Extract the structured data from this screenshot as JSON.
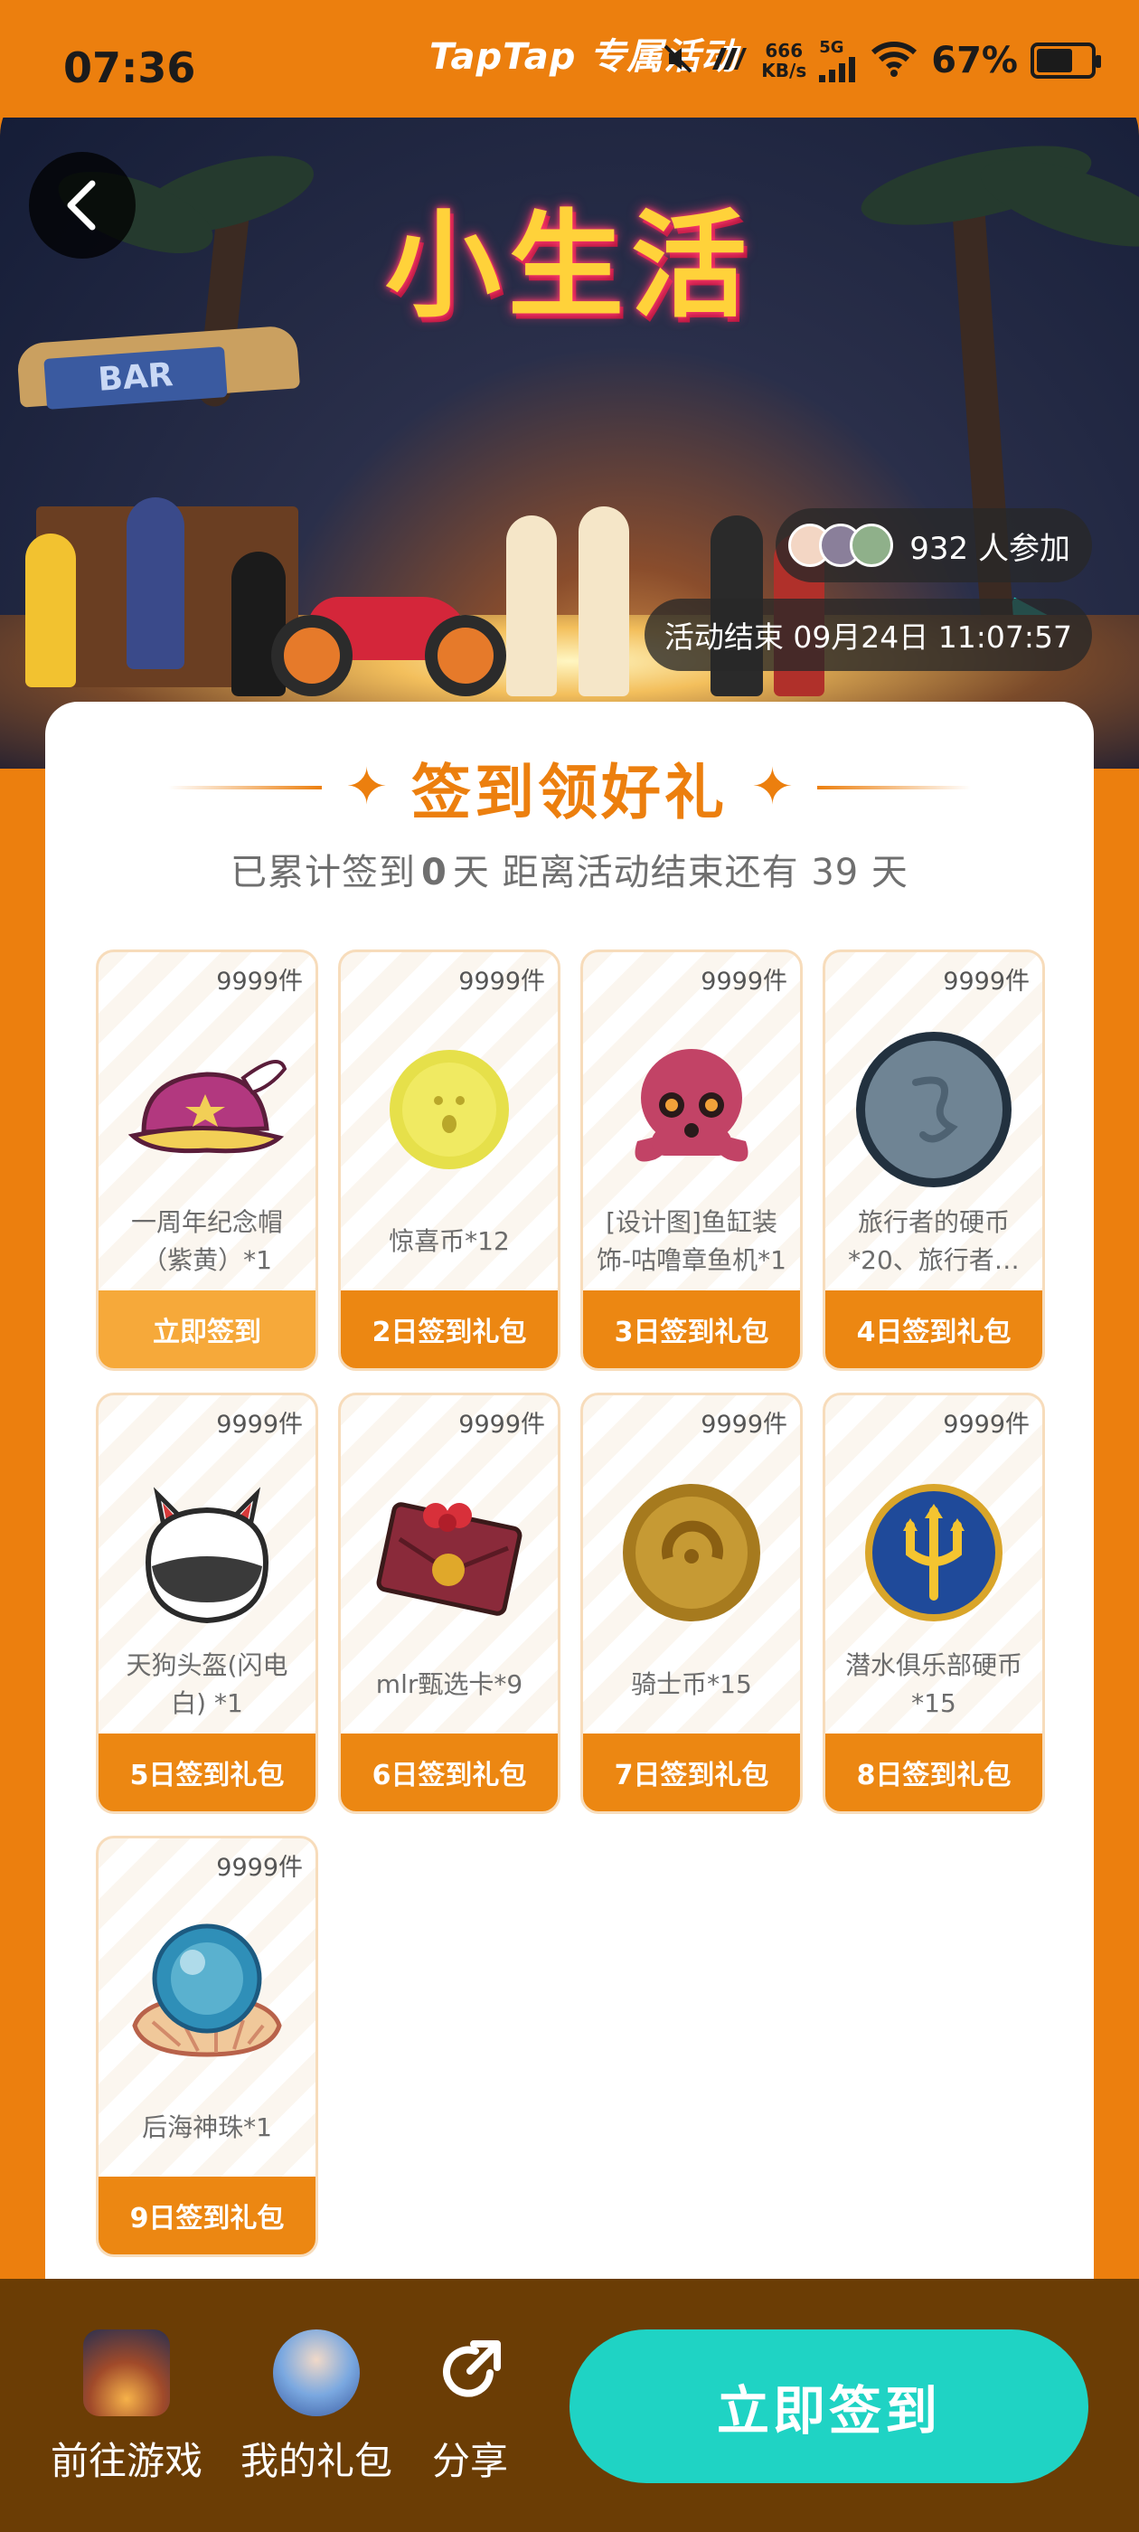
{
  "status_bar": {
    "time": "07:36",
    "app_brand": "TapTap 专属活动",
    "net_speed_value": "666",
    "net_speed_unit": "KB/s",
    "network": "5G",
    "battery_pct": "67%",
    "battery_level": 0.67
  },
  "hero": {
    "title": "小生活",
    "bar_sign": "BAR",
    "participants": "932 人参加",
    "end_time": "活动结束 09月24日 11:07:57"
  },
  "section": {
    "title": "签到领好礼",
    "summary_prefix": "已累计签到",
    "summary_days": "0",
    "summary_suffix": "天  距离活动结束还有 39 天"
  },
  "rewards": [
    {
      "stock": "9999件",
      "name": "一周年纪念帽（紫黄）*1",
      "button": "立即签到",
      "icon": "purple-yellow-cap-icon",
      "active": true
    },
    {
      "stock": "9999件",
      "name": "惊喜币*12",
      "button": "2日签到礼包",
      "icon": "surprise-coin-icon"
    },
    {
      "stock": "9999件",
      "name": "[设计图]鱼缸装饰-咕噜章鱼机*1",
      "button": "3日签到礼包",
      "icon": "octopus-icon"
    },
    {
      "stock": "9999件",
      "name": "旅行者的硬币*20、旅行者…",
      "button": "4日签到礼包",
      "icon": "traveler-coin-icon"
    },
    {
      "stock": "9999件",
      "name": "天狗头盔(闪电白) *1",
      "button": "5日签到礼包",
      "icon": "tengu-helmet-icon"
    },
    {
      "stock": "9999件",
      "name": "mlr甄选卡*9",
      "button": "6日签到礼包",
      "icon": "envelope-card-icon"
    },
    {
      "stock": "9999件",
      "name": "骑士币*15",
      "button": "7日签到礼包",
      "icon": "knight-coin-icon"
    },
    {
      "stock": "9999件",
      "name": "潜水俱乐部硬币*15",
      "button": "8日签到礼包",
      "icon": "diving-club-coin-icon"
    },
    {
      "stock": "9999件",
      "name": "后海神珠*1",
      "button": "9日签到礼包",
      "icon": "sea-pearl-icon"
    }
  ],
  "bottom_nav": {
    "go_game": "前往游戏",
    "my_gifts": "我的礼包",
    "share": "分享",
    "signin": "立即签到"
  },
  "colors": {
    "accent": "#EC7F0E",
    "teal": "#1FD3C4",
    "bottom_bar": "#6B3D05"
  }
}
